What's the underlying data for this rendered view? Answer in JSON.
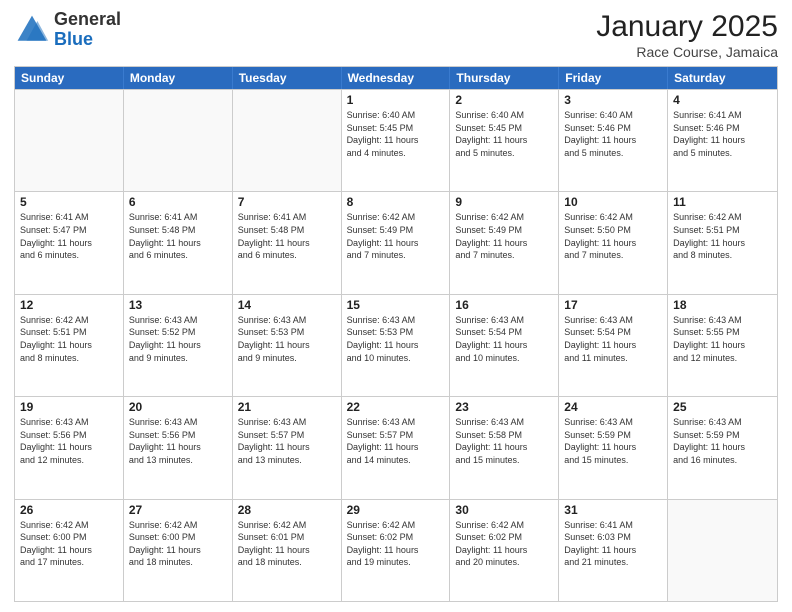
{
  "logo": {
    "general": "General",
    "blue": "Blue"
  },
  "header": {
    "month": "January 2025",
    "location": "Race Course, Jamaica"
  },
  "weekdays": [
    "Sunday",
    "Monday",
    "Tuesday",
    "Wednesday",
    "Thursday",
    "Friday",
    "Saturday"
  ],
  "rows": [
    [
      {
        "day": "",
        "text": "",
        "empty": true
      },
      {
        "day": "",
        "text": "",
        "empty": true
      },
      {
        "day": "",
        "text": "",
        "empty": true
      },
      {
        "day": "1",
        "text": "Sunrise: 6:40 AM\nSunset: 5:45 PM\nDaylight: 11 hours\nand 4 minutes."
      },
      {
        "day": "2",
        "text": "Sunrise: 6:40 AM\nSunset: 5:45 PM\nDaylight: 11 hours\nand 5 minutes."
      },
      {
        "day": "3",
        "text": "Sunrise: 6:40 AM\nSunset: 5:46 PM\nDaylight: 11 hours\nand 5 minutes."
      },
      {
        "day": "4",
        "text": "Sunrise: 6:41 AM\nSunset: 5:46 PM\nDaylight: 11 hours\nand 5 minutes."
      }
    ],
    [
      {
        "day": "5",
        "text": "Sunrise: 6:41 AM\nSunset: 5:47 PM\nDaylight: 11 hours\nand 6 minutes."
      },
      {
        "day": "6",
        "text": "Sunrise: 6:41 AM\nSunset: 5:48 PM\nDaylight: 11 hours\nand 6 minutes."
      },
      {
        "day": "7",
        "text": "Sunrise: 6:41 AM\nSunset: 5:48 PM\nDaylight: 11 hours\nand 6 minutes."
      },
      {
        "day": "8",
        "text": "Sunrise: 6:42 AM\nSunset: 5:49 PM\nDaylight: 11 hours\nand 7 minutes."
      },
      {
        "day": "9",
        "text": "Sunrise: 6:42 AM\nSunset: 5:49 PM\nDaylight: 11 hours\nand 7 minutes."
      },
      {
        "day": "10",
        "text": "Sunrise: 6:42 AM\nSunset: 5:50 PM\nDaylight: 11 hours\nand 7 minutes."
      },
      {
        "day": "11",
        "text": "Sunrise: 6:42 AM\nSunset: 5:51 PM\nDaylight: 11 hours\nand 8 minutes."
      }
    ],
    [
      {
        "day": "12",
        "text": "Sunrise: 6:42 AM\nSunset: 5:51 PM\nDaylight: 11 hours\nand 8 minutes."
      },
      {
        "day": "13",
        "text": "Sunrise: 6:43 AM\nSunset: 5:52 PM\nDaylight: 11 hours\nand 9 minutes."
      },
      {
        "day": "14",
        "text": "Sunrise: 6:43 AM\nSunset: 5:53 PM\nDaylight: 11 hours\nand 9 minutes."
      },
      {
        "day": "15",
        "text": "Sunrise: 6:43 AM\nSunset: 5:53 PM\nDaylight: 11 hours\nand 10 minutes."
      },
      {
        "day": "16",
        "text": "Sunrise: 6:43 AM\nSunset: 5:54 PM\nDaylight: 11 hours\nand 10 minutes."
      },
      {
        "day": "17",
        "text": "Sunrise: 6:43 AM\nSunset: 5:54 PM\nDaylight: 11 hours\nand 11 minutes."
      },
      {
        "day": "18",
        "text": "Sunrise: 6:43 AM\nSunset: 5:55 PM\nDaylight: 11 hours\nand 12 minutes."
      }
    ],
    [
      {
        "day": "19",
        "text": "Sunrise: 6:43 AM\nSunset: 5:56 PM\nDaylight: 11 hours\nand 12 minutes."
      },
      {
        "day": "20",
        "text": "Sunrise: 6:43 AM\nSunset: 5:56 PM\nDaylight: 11 hours\nand 13 minutes."
      },
      {
        "day": "21",
        "text": "Sunrise: 6:43 AM\nSunset: 5:57 PM\nDaylight: 11 hours\nand 13 minutes."
      },
      {
        "day": "22",
        "text": "Sunrise: 6:43 AM\nSunset: 5:57 PM\nDaylight: 11 hours\nand 14 minutes."
      },
      {
        "day": "23",
        "text": "Sunrise: 6:43 AM\nSunset: 5:58 PM\nDaylight: 11 hours\nand 15 minutes."
      },
      {
        "day": "24",
        "text": "Sunrise: 6:43 AM\nSunset: 5:59 PM\nDaylight: 11 hours\nand 15 minutes."
      },
      {
        "day": "25",
        "text": "Sunrise: 6:43 AM\nSunset: 5:59 PM\nDaylight: 11 hours\nand 16 minutes."
      }
    ],
    [
      {
        "day": "26",
        "text": "Sunrise: 6:42 AM\nSunset: 6:00 PM\nDaylight: 11 hours\nand 17 minutes."
      },
      {
        "day": "27",
        "text": "Sunrise: 6:42 AM\nSunset: 6:00 PM\nDaylight: 11 hours\nand 18 minutes."
      },
      {
        "day": "28",
        "text": "Sunrise: 6:42 AM\nSunset: 6:01 PM\nDaylight: 11 hours\nand 18 minutes."
      },
      {
        "day": "29",
        "text": "Sunrise: 6:42 AM\nSunset: 6:02 PM\nDaylight: 11 hours\nand 19 minutes."
      },
      {
        "day": "30",
        "text": "Sunrise: 6:42 AM\nSunset: 6:02 PM\nDaylight: 11 hours\nand 20 minutes."
      },
      {
        "day": "31",
        "text": "Sunrise: 6:41 AM\nSunset: 6:03 PM\nDaylight: 11 hours\nand 21 minutes."
      },
      {
        "day": "",
        "text": "",
        "empty": true
      }
    ]
  ]
}
